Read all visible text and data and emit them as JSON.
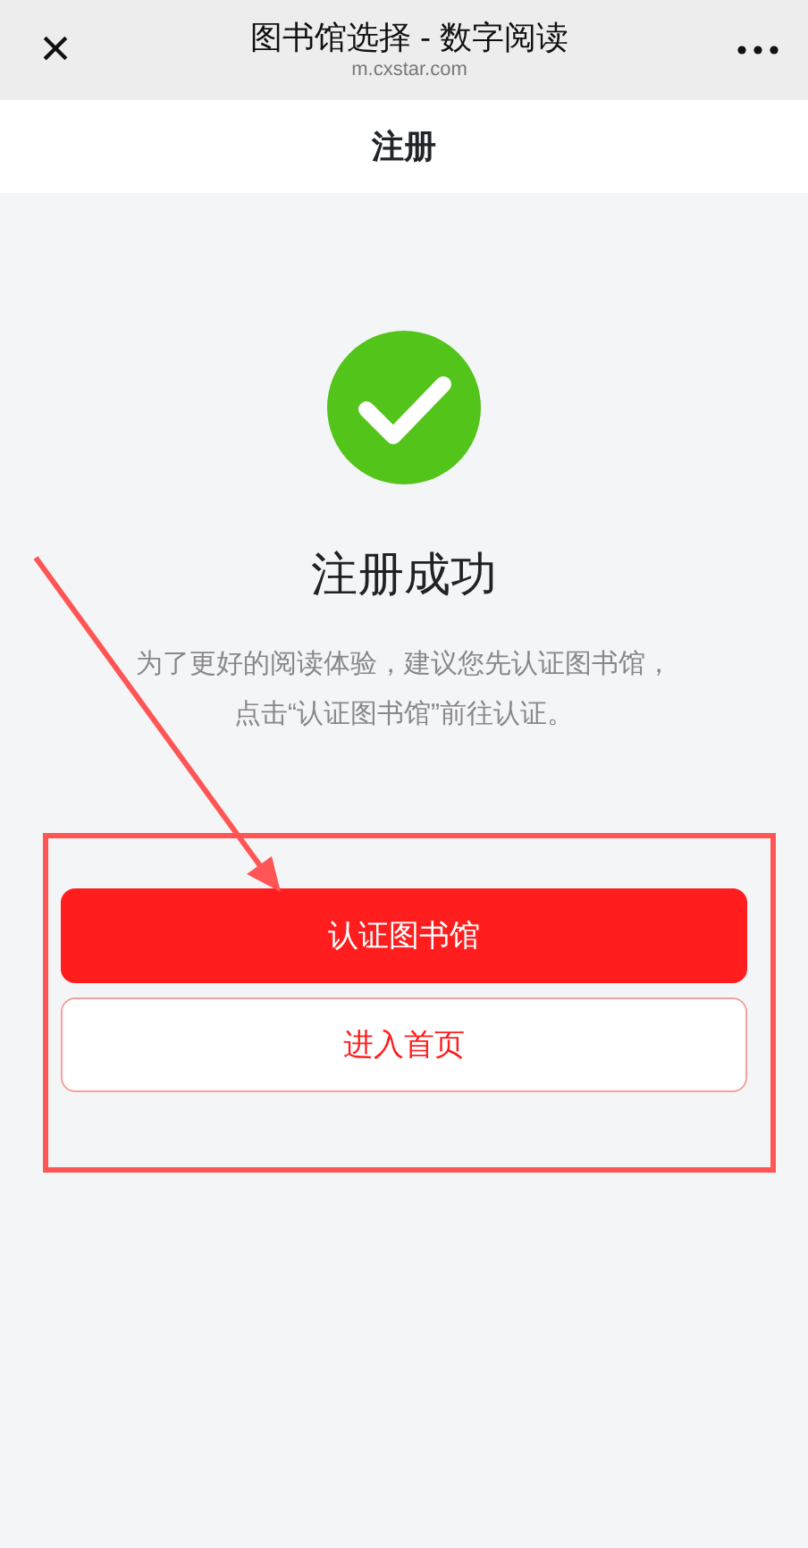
{
  "window": {
    "title": "图书馆选择 - 数字阅读",
    "url": "m.cxstar.com",
    "close": "×"
  },
  "header": {
    "title": "注册"
  },
  "result": {
    "success": true,
    "title": "注册成功",
    "message": [
      "为了更好的阅读体验，建议您先认证图书馆，",
      "点击“认证图书馆”前往认证。"
    ]
  },
  "buttons": [
    {
      "label": "认证图书馆",
      "kind": "primary"
    },
    {
      "label": "进入首页",
      "kind": "outline"
    }
  ]
}
